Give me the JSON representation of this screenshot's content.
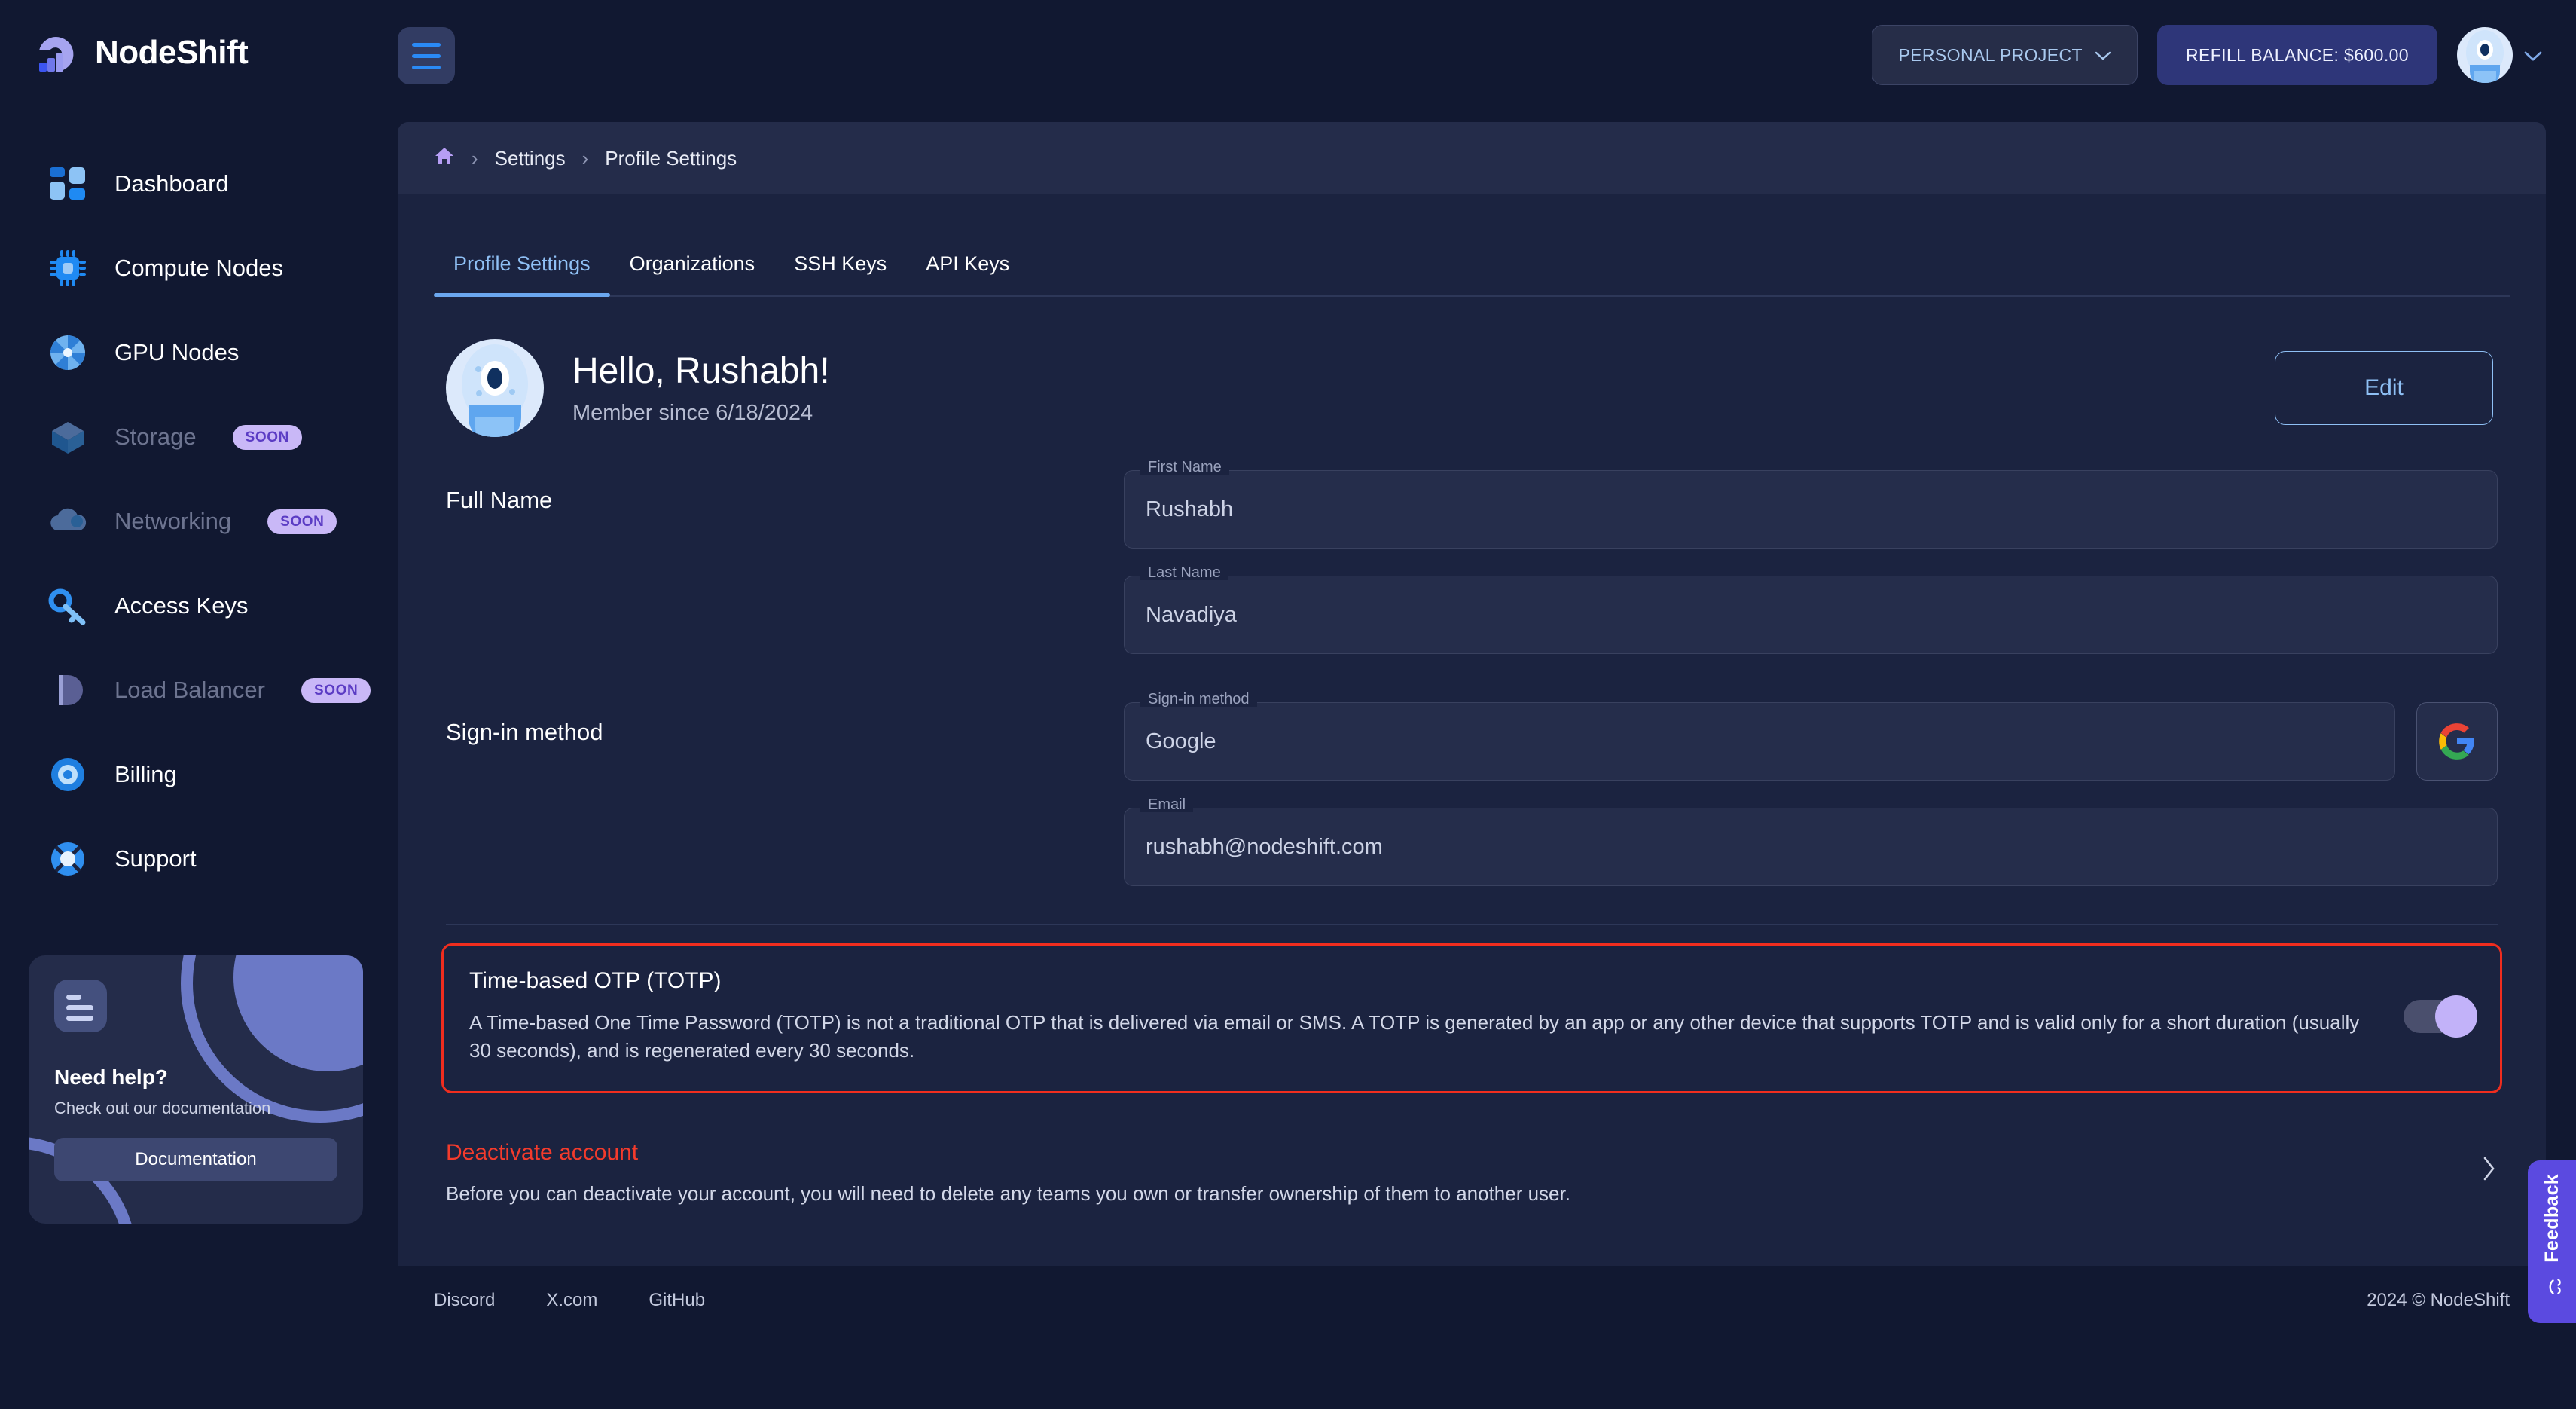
{
  "brand": {
    "name": "NodeShift",
    "logo_icon": "nodeshift-wave-logo"
  },
  "sidebar": {
    "items": [
      {
        "label": "Dashboard",
        "icon": "dashboard-grid-icon",
        "badge": null,
        "dim": false
      },
      {
        "label": "Compute Nodes",
        "icon": "cpu-chip-icon",
        "badge": null,
        "dim": false
      },
      {
        "label": "GPU Nodes",
        "icon": "gpu-fan-icon",
        "badge": null,
        "dim": false
      },
      {
        "label": "Storage",
        "icon": "cube-icon",
        "badge": "SOON",
        "dim": true
      },
      {
        "label": "Networking",
        "icon": "cloud-icon",
        "badge": "SOON",
        "dim": true
      },
      {
        "label": "Access Keys",
        "icon": "key-icon",
        "badge": null,
        "dim": false
      },
      {
        "label": "Load Balancer",
        "icon": "load-balancer-icon",
        "badge": "SOON",
        "dim": true
      },
      {
        "label": "Billing",
        "icon": "billing-icon",
        "badge": null,
        "dim": false
      },
      {
        "label": "Support",
        "icon": "support-icon",
        "badge": null,
        "dim": false
      }
    ],
    "help_card": {
      "icon": "document-lines-icon",
      "title": "Need help?",
      "subtitle": "Check out our documentation",
      "button_label": "Documentation"
    }
  },
  "topbar": {
    "menu_icon": "hamburger-menu-icon",
    "project_label": "PERSONAL PROJECT",
    "project_chevron": "chevron-down-icon",
    "refill_label": "REFILL BALANCE:  $600.00",
    "avatar_icon": "user-avatar",
    "avatar_chevron": "chevron-down-icon"
  },
  "breadcrumb": {
    "home_icon": "home-icon",
    "separator": "›",
    "items": [
      "Settings",
      "Profile Settings"
    ]
  },
  "tabs": [
    {
      "label": "Profile Settings",
      "active": true
    },
    {
      "label": "Organizations",
      "active": false
    },
    {
      "label": "SSH Keys",
      "active": false
    },
    {
      "label": "API Keys",
      "active": false
    }
  ],
  "profile": {
    "avatar_icon": "user-avatar",
    "greeting": "Hello, Rushabh!",
    "member_since": "Member since 6/18/2024",
    "edit_label": "Edit"
  },
  "full_name": {
    "section_title": "Full Name",
    "first_name": {
      "label": "First Name",
      "value": "Rushabh"
    },
    "last_name": {
      "label": "Last Name",
      "value": "Navadiya"
    }
  },
  "signin": {
    "section_title": "Sign-in method",
    "method": {
      "label": "Sign-in method",
      "value": "Google"
    },
    "provider_icon": "google-g-icon",
    "email": {
      "label": "Email",
      "value": "rushabh@nodeshift.com"
    }
  },
  "totp": {
    "title": "Time-based OTP (TOTP)",
    "description": "A Time-based One Time Password (TOTP) is not a traditional OTP that is delivered via email or SMS. A TOTP is generated by an app or any other device that supports TOTP and is valid only for a short duration (usually 30 seconds), and is regenerated every 30 seconds.",
    "toggle_on": true,
    "highlight_color": "#f02d1e"
  },
  "deactivate": {
    "title": "Deactivate account",
    "description": "Before you can deactivate your account, you will need to delete any teams you own or transfer ownership of them to another user.",
    "chevron_icon": "chevron-right-icon",
    "title_color": "#f43b2c"
  },
  "footer": {
    "links": [
      "Discord",
      "X.com",
      "GitHub"
    ],
    "copyright": "2024 © NodeShift"
  },
  "feedback": {
    "label": "Feedback",
    "icon": "smiley-face-icon",
    "color": "#5b4ae0"
  }
}
